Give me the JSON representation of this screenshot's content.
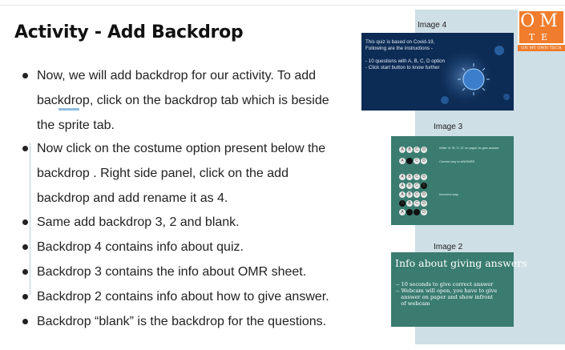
{
  "title": "Activity  - Add Backdrop",
  "bullets": [
    "Now, we will add backdrop for our activity. To add",
    "backdrop, click on the backdrop tab which is beside",
    "the sprite tab.",
    "Now click on the costume option present below the",
    "backdrop . Right side panel, click on the add",
    "backdrop and add rename it as 4.",
    "Same add backdrop 3, 2 and blank.",
    "Backdrop 4 contains info about quiz.",
    "Backdrop 3 contains the info  about OMR sheet.",
    "Backdrop 2 contains info about how to give answer.",
    "Backdrop “blank” is the backdrop for the questions."
  ],
  "logo": {
    "line1": "OM",
    "line2": "TE",
    "tagline": "ON MY OWN TECH"
  },
  "image4": {
    "caption": "Image 4",
    "text": "This quiz is based on Covid-19,\nFollowing are the instructions -\n\n- 10 questions with A, B, C, D option\n- Click start button to know further"
  },
  "image3": {
    "caption": "Image 3",
    "note1": "Write 'A','B','C','D' on paper\nto give answer",
    "note2": "Correct way to ANSWER",
    "note3": "Incorrect way"
  },
  "image2": {
    "caption": "Image 2",
    "heading": "Info about giving answers",
    "body": "-- 10 seconds to give correct answer\n-- Webcam will open, you have to give\n   answer on paper and show infront\n   of webcam"
  }
}
